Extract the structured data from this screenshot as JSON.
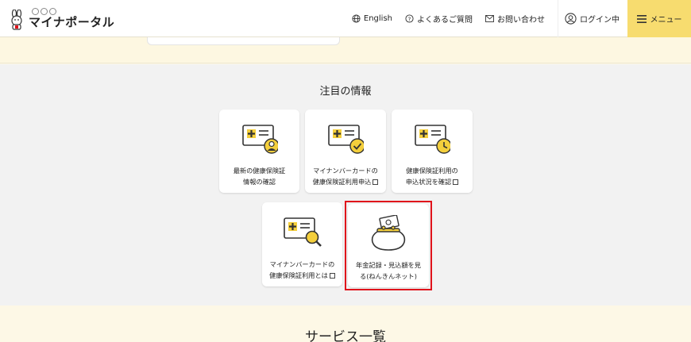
{
  "header": {
    "logo_text": "マイナポータル",
    "nav": {
      "english": "English",
      "faq": "よくあるご質問",
      "contact": "お問い合わせ",
      "login": "ログイン中",
      "menu": "メニュー"
    }
  },
  "featured": {
    "title": "注目の情報",
    "tiles": [
      {
        "line1": "最新の健康保険証",
        "line2": "情報の確認",
        "icon": "insurance-card-person-icon",
        "external": false
      },
      {
        "line1": "マイナンバーカードの",
        "line2": "健康保険証利用申込",
        "icon": "insurance-card-check-icon",
        "external": true
      },
      {
        "line1": "健康保険証利用の",
        "line2": "申込状況を確認",
        "icon": "insurance-card-clock-icon",
        "external": true
      },
      {
        "line1": "マイナンバーカードの",
        "line2": "健康保険証利用とは",
        "icon": "insurance-card-magnifier-icon",
        "external": true
      },
      {
        "line1": "年金記録・見込額を見",
        "line2": "る(ねんきんネット)",
        "icon": "coin-purse-icon",
        "external": false
      }
    ]
  },
  "services": {
    "title": "サービス一覧"
  },
  "colors": {
    "accent_yellow": "#f7dc6f",
    "highlight_red": "#e0121b",
    "icon_yellow": "#f4cf3c"
  }
}
